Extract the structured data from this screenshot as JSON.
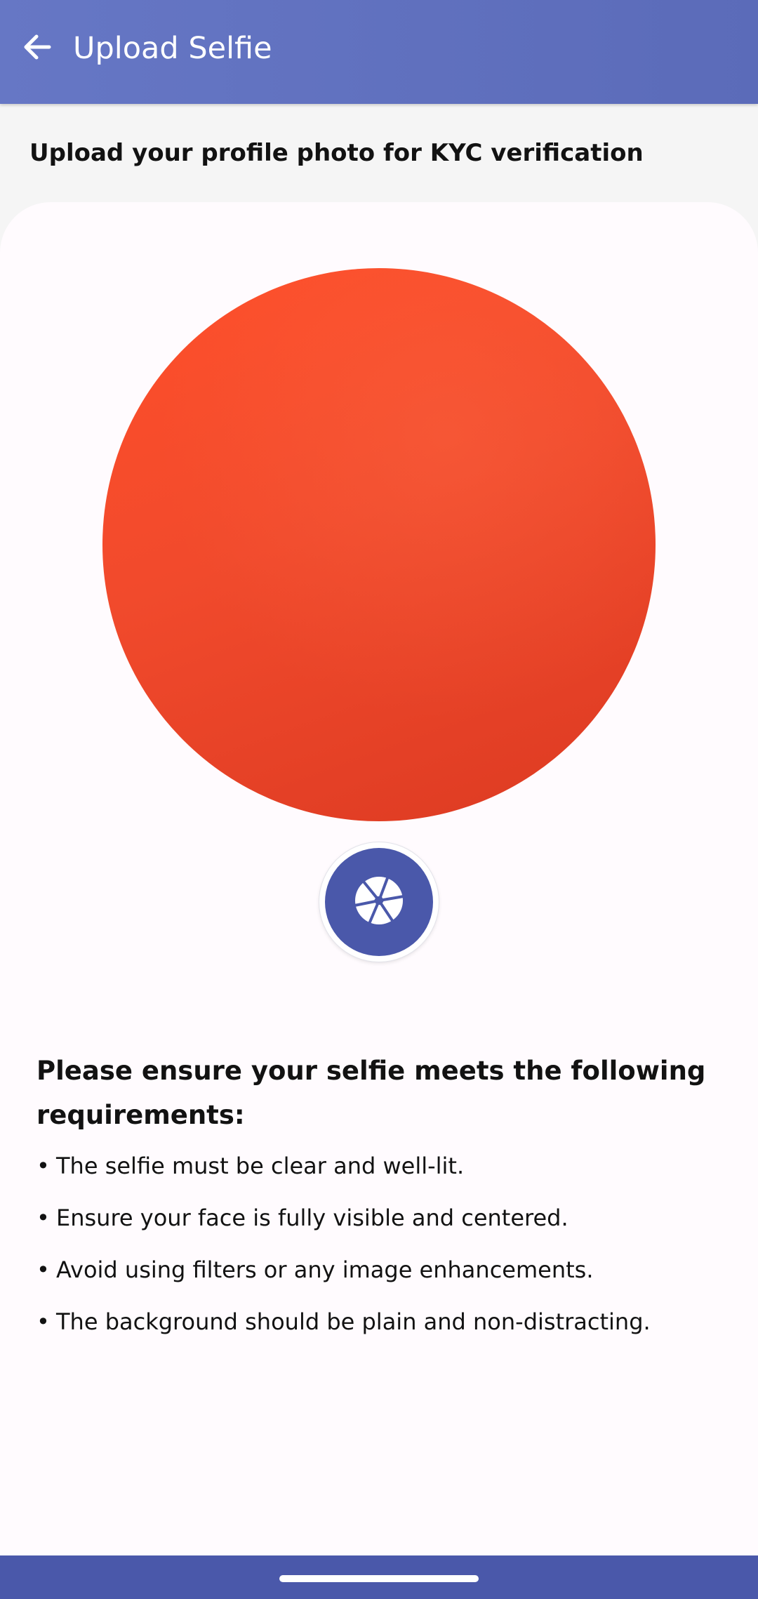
{
  "app_bar": {
    "title": "Upload Selfie",
    "back_icon": "arrow-left-icon",
    "background_color": "#6272c2"
  },
  "header": {
    "subtitle": "Upload your profile photo for KYC verification"
  },
  "photo_preview": {
    "fill_color": "#ef4a2b"
  },
  "capture_button": {
    "icon": "camera-shutter-icon",
    "background_color": "#4a58aa"
  },
  "requirements": {
    "title": "Please ensure your selfie meets the following requirements:",
    "bullet": "•",
    "items": [
      "The selfie must be clear and well-lit.",
      "Ensure your face is fully visible and centered.",
      "Avoid using filters or any image enhancements.",
      "The background should be plain and non-distracting."
    ]
  },
  "system_nav": {
    "background_color": "#4a58aa"
  }
}
